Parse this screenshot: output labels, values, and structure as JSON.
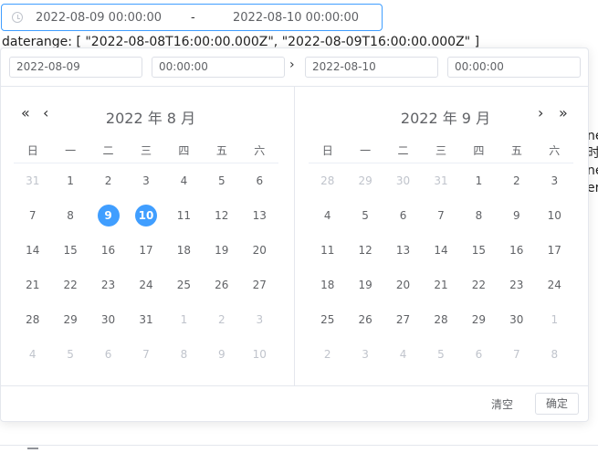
{
  "range_input": {
    "start": "2022-08-09 00:00:00",
    "separator": "-",
    "end": "2022-08-10 00:00:00"
  },
  "background_text": "daterange: [ \"2022-08-08T16:00:00.000Z\", \"2022-08-09T16:00:00.000Z\" ]",
  "side_letters": [
    "ne",
    "时,",
    "ne",
    "er"
  ],
  "time_header": {
    "start_date": "2022-08-09",
    "start_time": "00:00:00",
    "arrow": "›",
    "end_date": "2022-08-10",
    "end_time": "00:00:00"
  },
  "nav": {
    "prev_year": "«",
    "prev_month": "‹",
    "next_month": "›",
    "next_year": "»"
  },
  "weekdays": [
    "日",
    "一",
    "二",
    "三",
    "四",
    "五",
    "六"
  ],
  "left_calendar": {
    "title": "2022 年 8 月",
    "weeks": [
      [
        "31",
        "1",
        "2",
        "3",
        "4",
        "5",
        "6"
      ],
      [
        "7",
        "8",
        "9",
        "10",
        "11",
        "12",
        "13"
      ],
      [
        "14",
        "15",
        "16",
        "17",
        "18",
        "19",
        "20"
      ],
      [
        "21",
        "22",
        "23",
        "24",
        "25",
        "26",
        "27"
      ],
      [
        "28",
        "29",
        "30",
        "31",
        "1",
        "2",
        "3"
      ],
      [
        "4",
        "5",
        "6",
        "7",
        "8",
        "9",
        "10"
      ]
    ]
  },
  "right_calendar": {
    "title": "2022 年 9 月",
    "weeks": [
      [
        "28",
        "29",
        "30",
        "31",
        "1",
        "2",
        "3"
      ],
      [
        "4",
        "5",
        "6",
        "7",
        "8",
        "9",
        "10"
      ],
      [
        "11",
        "12",
        "13",
        "14",
        "15",
        "16",
        "17"
      ],
      [
        "18",
        "19",
        "20",
        "21",
        "22",
        "23",
        "24"
      ],
      [
        "25",
        "26",
        "27",
        "28",
        "29",
        "30",
        "1"
      ],
      [
        "2",
        "3",
        "4",
        "5",
        "6",
        "7",
        "8"
      ]
    ]
  },
  "footer": {
    "clear_label": "清空",
    "confirm_label": "确定"
  },
  "colors": {
    "accent": "#409eff",
    "muted": "#c0c4cc"
  }
}
